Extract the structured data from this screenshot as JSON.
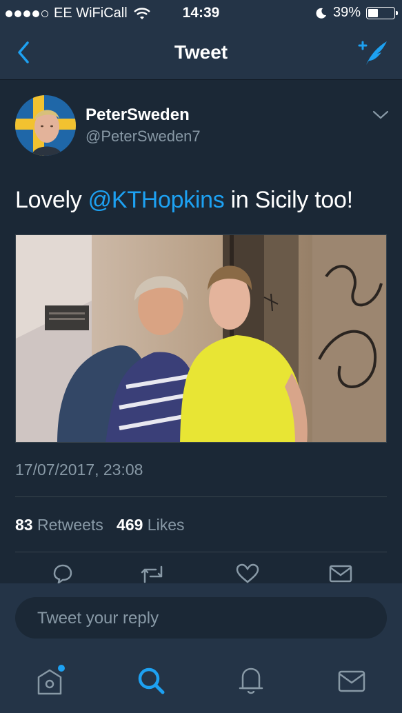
{
  "status": {
    "carrier": "EE WiFiCall",
    "time": "14:39",
    "battery": "39%",
    "signal_bars_filled": 4,
    "signal_bars_total": 5
  },
  "nav": {
    "title": "Tweet"
  },
  "tweet": {
    "author_name": "PeterSweden",
    "author_handle": "@PeterSweden7",
    "text_before": "Lovely ",
    "mention": "@KTHopkins",
    "text_after": " in Sicily too!",
    "timestamp": "17/07/2017, 23:08",
    "retweets_count": "83",
    "retweets_label": "Retweets",
    "likes_count": "469",
    "likes_label": "Likes"
  },
  "reply": {
    "placeholder": "Tweet your reply"
  },
  "tabs": [
    {
      "icon": "home-icon",
      "active": false,
      "badge": true
    },
    {
      "icon": "search-icon",
      "active": true,
      "badge": false
    },
    {
      "icon": "notifications-icon",
      "active": false,
      "badge": false
    },
    {
      "icon": "messages-icon",
      "active": false,
      "badge": false
    }
  ],
  "colors": {
    "background": "#1b2836",
    "bar": "#243447",
    "accent": "#1da1f2",
    "muted": "#8899a6"
  }
}
